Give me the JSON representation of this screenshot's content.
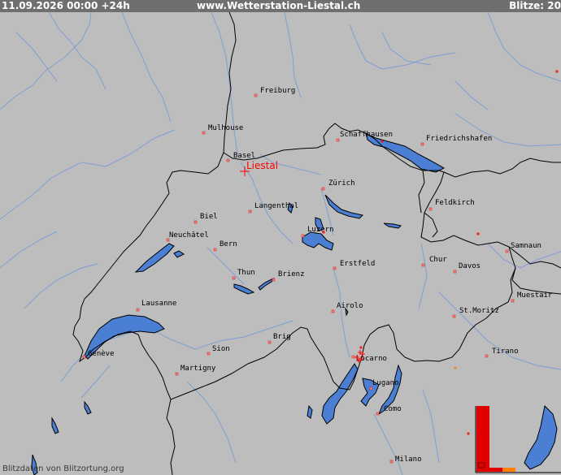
{
  "header": {
    "date_text": "11.09.2026 00:00 +24h",
    "site_text": "www.Wetterstation-Liestal.ch",
    "count_text": "Blitze: 20"
  },
  "footer": {
    "credit_text": "Blitzdaten von Blitzortung.org"
  },
  "station": {
    "name": "Liestal",
    "color": "#ff0000"
  },
  "colors": {
    "land": "#bdbdbd",
    "lake": "#4a7fd4",
    "river": "#7f9fd4",
    "border": "#000000",
    "header_bg": "#6f6f6f",
    "strike": "#ff0000",
    "histogram_recent": "#e00000",
    "histogram_old": "#ff8000"
  },
  "cities": [
    {
      "name": "Freiburg"
    },
    {
      "name": "Mulhouse"
    },
    {
      "name": "Basel"
    },
    {
      "name": "Schaffhausen"
    },
    {
      "name": "Friedrichshafen"
    },
    {
      "name": "Zürich"
    },
    {
      "name": "Feldkirch"
    },
    {
      "name": "Langenthal"
    },
    {
      "name": "Biel"
    },
    {
      "name": "Luzern"
    },
    {
      "name": "Neuchâtel"
    },
    {
      "name": "Bern"
    },
    {
      "name": "Samnaun"
    },
    {
      "name": "Chur"
    },
    {
      "name": "Davos"
    },
    {
      "name": "Erstfeld"
    },
    {
      "name": "Thun"
    },
    {
      "name": "Brienz"
    },
    {
      "name": "Muestair"
    },
    {
      "name": "Lausanne"
    },
    {
      "name": "Airolo"
    },
    {
      "name": "St.Moritz"
    },
    {
      "name": "Brig"
    },
    {
      "name": "Genève"
    },
    {
      "name": "Sion"
    },
    {
      "name": "Tirano"
    },
    {
      "name": "Locarno"
    },
    {
      "name": "Martigny"
    },
    {
      "name": "Lugano"
    },
    {
      "name": "Como"
    },
    {
      "name": "Milano"
    }
  ]
}
